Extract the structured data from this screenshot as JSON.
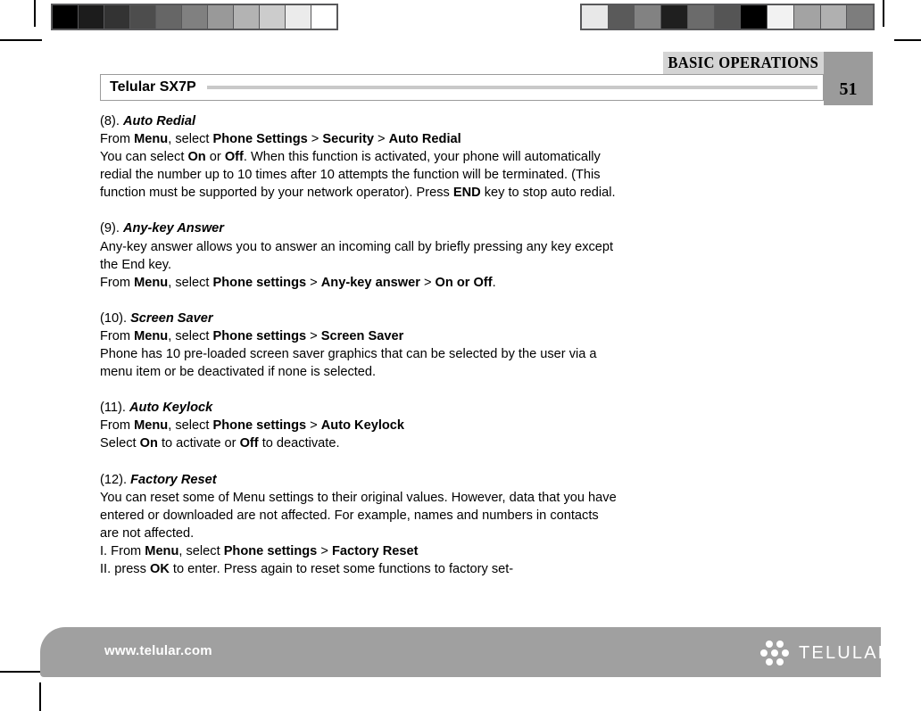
{
  "calibration": {
    "left_strip": {
      "name": "grayscale-calibration-strip-left",
      "patches": [
        "#000000",
        "#1c1c1c",
        "#333333",
        "#4d4d4d",
        "#666666",
        "#808080",
        "#999999",
        "#b3b3b3",
        "#cccccc",
        "#ebebeb",
        "#ffffff"
      ]
    },
    "right_strip": {
      "name": "grayscale-calibration-strip-right",
      "patches": [
        "#e8e8e8",
        "#5a5a5a",
        "#828282",
        "#1f1f1f",
        "#6b6b6b",
        "#555555",
        "#000000",
        "#f2f2f2",
        "#a3a3a3",
        "#b0b0b0",
        "#7d7d7d"
      ]
    }
  },
  "header": {
    "section_tab": "BASIC OPERATIONS",
    "page_number": "51",
    "doc_title": "Telular SX7P"
  },
  "content": {
    "sections": [
      {
        "number": "(8).",
        "heading": "Auto Redial",
        "lines": [
          "From <b>Menu</b>, select <b>Phone Settings</b> > <b>Security</b> > <b>Auto Redial</b>",
          "You can select <b>On</b> or <b>Off</b>. When this function is activated, your phone will automatically redial the number up to 10 times after 10 attempts the function will be terminated. (This function must be supported by your network operator). Press <b>END</b> key to stop auto redial."
        ]
      },
      {
        "number": "(9).",
        "heading": "Any-key Answer",
        "lines": [
          "Any-key answer allows you to answer an incoming call by briefly pressing any key except the End key.",
          "From <b>Menu</b>, select <b>Phone settings</b> > <b>Any-key answer</b> > <b>On or Off</b>."
        ]
      },
      {
        "number": "(10).",
        "heading": "Screen Saver",
        "lines": [
          "From <b>Menu</b>, select <b>Phone settings</b> > <b>Screen Saver</b>",
          "Phone has 10 pre-loaded screen saver graphics that can be selected by the user via a menu item or be deactivated if none is selected."
        ]
      },
      {
        "number": "(11).",
        "heading": "Auto Keylock",
        "lines": [
          "From <b>Menu</b>, select <b>Phone settings</b> > <b>Auto Keylock</b>",
          "Select <b>On</b> to activate or <b>Off</b> to deactivate."
        ]
      },
      {
        "number": "(12).",
        "heading": "Factory Reset",
        "lines": [
          "You can reset some of Menu settings to their original values. However, data that you have entered or downloaded are not affected. For example, names and numbers in contacts are not affected.",
          "I. From <b>Menu</b>, select <b>Phone settings</b> > <b>Factory Reset</b>",
          "II. press <b>OK</b> to enter. Press again to reset some functions to factory set-"
        ]
      }
    ]
  },
  "footer": {
    "url": "www.telular.com",
    "logo_wordmark": "TELULAR",
    "bar_color": "#a0a0a0"
  }
}
